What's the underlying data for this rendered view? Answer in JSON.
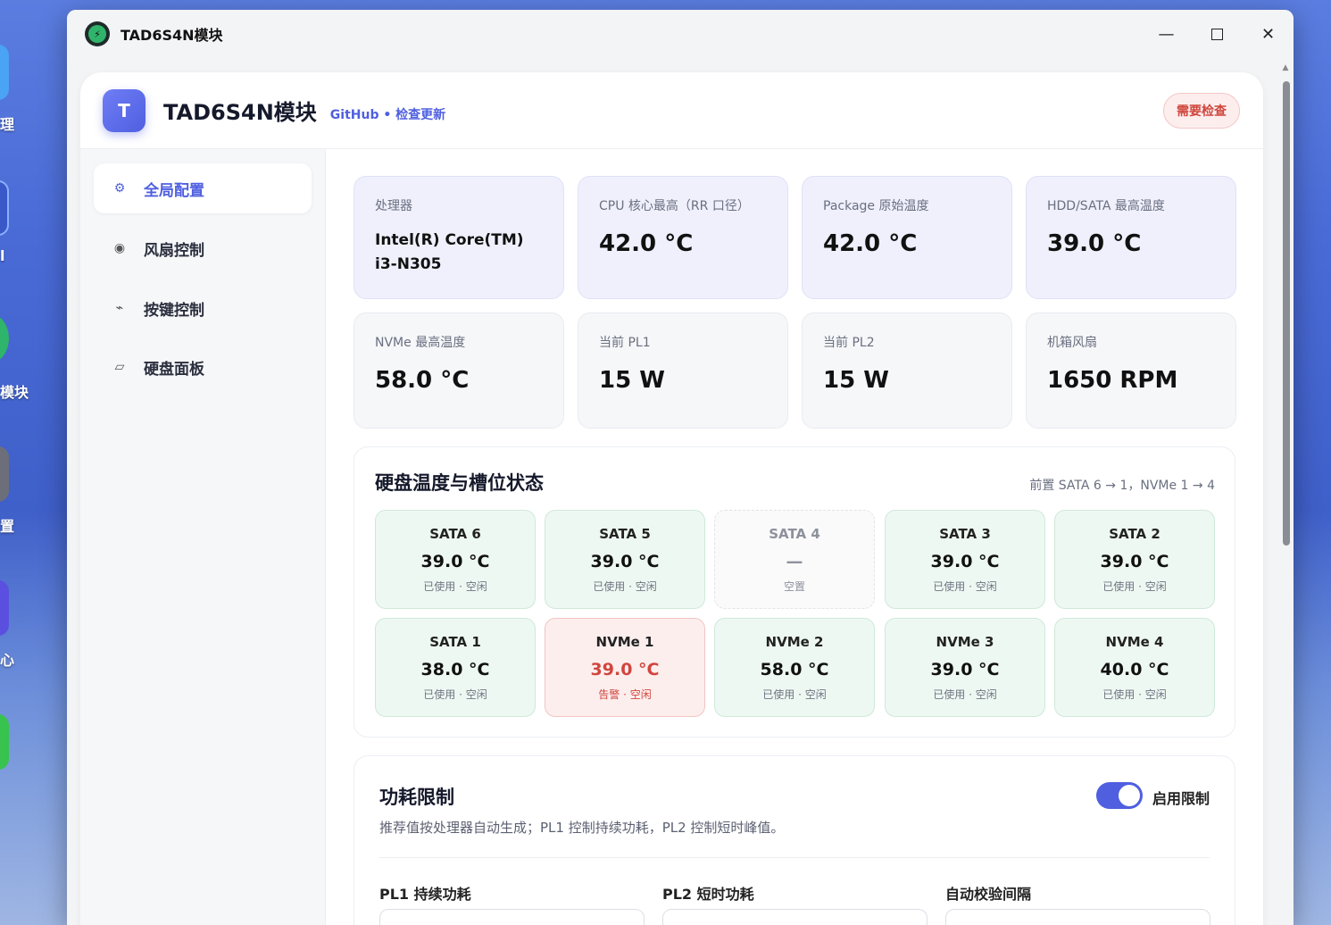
{
  "desktop": {
    "labels": [
      "理",
      "l",
      "模块",
      "置",
      "心"
    ]
  },
  "window": {
    "title": "TAD6S4N模块",
    "logo_icon": "lightning-shield-icon",
    "controls": [
      "minimize",
      "maximize",
      "close"
    ]
  },
  "header": {
    "badge": "T",
    "title": "TAD6S4N模块",
    "link_github": "GitHub",
    "link_separator": "•",
    "link_update": "检查更新",
    "status": "需要检查"
  },
  "sidebar": {
    "items": [
      {
        "label": "全局配置",
        "icon": "gear-icon",
        "glyph": "⚙",
        "active": true
      },
      {
        "label": "风扇控制",
        "icon": "fan-icon",
        "glyph": "◉",
        "active": false
      },
      {
        "label": "按键控制",
        "icon": "key-icon",
        "glyph": "⌁",
        "active": false
      },
      {
        "label": "硬盘面板",
        "icon": "disk-panel-icon",
        "glyph": "▱",
        "active": false
      }
    ]
  },
  "stats": [
    {
      "label": "处理器",
      "value": "Intel(R) Core(TM) i3-N305"
    },
    {
      "label": "CPU 核心最高（RR 口径）",
      "value": "42.0 °C"
    },
    {
      "label": "Package 原始温度",
      "value": "42.0 °C"
    },
    {
      "label": "HDD/SATA 最高温度",
      "value": "39.0 °C"
    },
    {
      "label": "NVMe 最高温度",
      "value": "58.0 °C"
    },
    {
      "label": "当前 PL1",
      "value": "15 W"
    },
    {
      "label": "当前 PL2",
      "value": "15 W"
    },
    {
      "label": "机箱风扇",
      "value": "1650 RPM"
    }
  ],
  "disks": {
    "title": "硬盘温度与槽位状态",
    "note": "前置 SATA 6 → 1，NVMe 1 → 4",
    "slots": [
      {
        "name": "SATA 6",
        "temp": "39.0 °C",
        "status": "已使用 · 空闲",
        "state": "ok"
      },
      {
        "name": "SATA 5",
        "temp": "39.0 °C",
        "status": "已使用 · 空闲",
        "state": "ok"
      },
      {
        "name": "SATA 4",
        "temp": "—",
        "status": "空置",
        "state": "empty"
      },
      {
        "name": "SATA 3",
        "temp": "39.0 °C",
        "status": "已使用 · 空闲",
        "state": "ok"
      },
      {
        "name": "SATA 2",
        "temp": "39.0 °C",
        "status": "已使用 · 空闲",
        "state": "ok"
      },
      {
        "name": "SATA 1",
        "temp": "38.0 °C",
        "status": "已使用 · 空闲",
        "state": "ok"
      },
      {
        "name": "NVMe 1",
        "temp": "39.0 °C",
        "status": "告警 · 空闲",
        "state": "warn"
      },
      {
        "name": "NVMe 2",
        "temp": "58.0 °C",
        "status": "已使用 · 空闲",
        "state": "ok"
      },
      {
        "name": "NVMe 3",
        "temp": "39.0 °C",
        "status": "已使用 · 空闲",
        "state": "ok"
      },
      {
        "name": "NVMe 4",
        "temp": "40.0 °C",
        "status": "已使用 · 空闲",
        "state": "ok"
      }
    ]
  },
  "power": {
    "title": "功耗限制",
    "toggle_label": "启用限制",
    "toggle_on": true,
    "description": "推荐值按处理器自动生成；PL1 控制持续功耗，PL2 控制短时峰值。",
    "fields": [
      {
        "label": "PL1 持续功耗",
        "value": ""
      },
      {
        "label": "PL2 短时功耗",
        "value": ""
      },
      {
        "label": "自动校验间隔",
        "value": ""
      }
    ]
  },
  "colors": {
    "accent": "#4f5fe0",
    "ok_bg": "#eef8f2",
    "warn_bg": "#fdeeee",
    "warn_text": "#d0463d"
  }
}
